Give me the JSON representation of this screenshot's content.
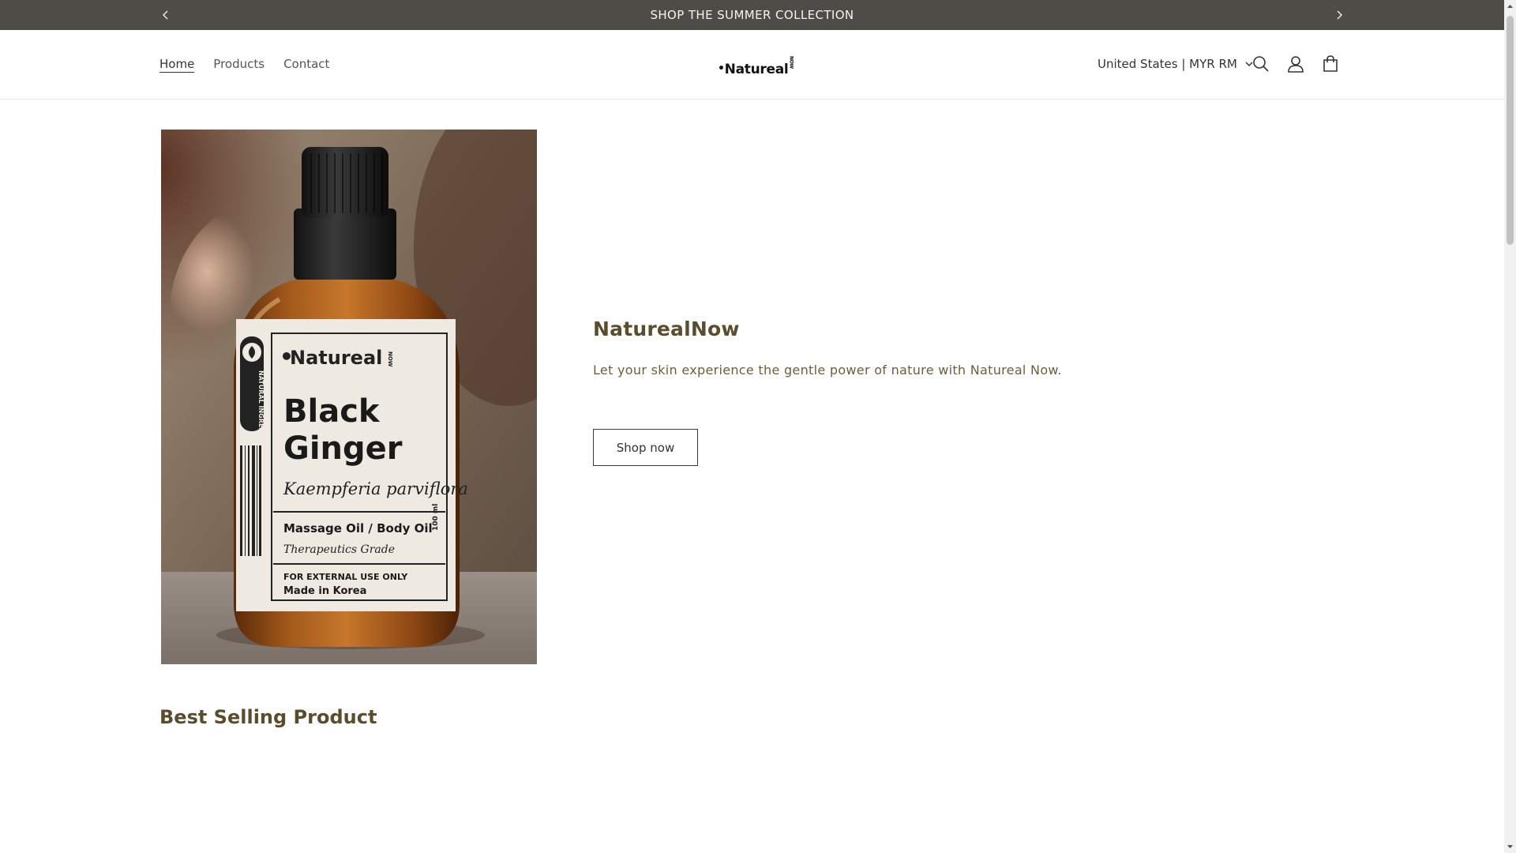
{
  "announcement": {
    "text": "SHOP THE SUMMER COLLECTION",
    "prev_icon": "chevron-left-icon",
    "next_icon": "chevron-right-icon"
  },
  "header": {
    "nav": [
      {
        "label": "Home",
        "active": true
      },
      {
        "label": "Products",
        "active": false
      },
      {
        "label": "Contact",
        "active": false
      }
    ],
    "logo": {
      "text": "Natureal",
      "mini": "NOW"
    },
    "country_selector": "United States | MYR RM",
    "icons": [
      "search-icon",
      "account-icon",
      "cart-icon"
    ]
  },
  "hero": {
    "title": "NaturealNow",
    "subtitle": "Let your skin experience the gentle power of nature with Natureal Now.",
    "button_label": "Shop now",
    "image": {
      "brand": "Natureal",
      "brand_mini": "NOW",
      "side_text": "NATURAL INGREDIENTS",
      "product_line1": "Black",
      "product_line2": "Ginger",
      "latin": "Kaempferia parviflora",
      "type": "Massage Oil / Body Oil",
      "grade": "Therapeutics Grade",
      "volume": "100 ml",
      "warning": "FOR EXTERNAL USE ONLY",
      "origin": "Made in Korea"
    }
  },
  "section": {
    "title": "Best Selling Product"
  },
  "colors": {
    "announcement_bg": "#4d4c47",
    "heading": "#5b4c2c",
    "body_text": "#6e5e3b"
  }
}
